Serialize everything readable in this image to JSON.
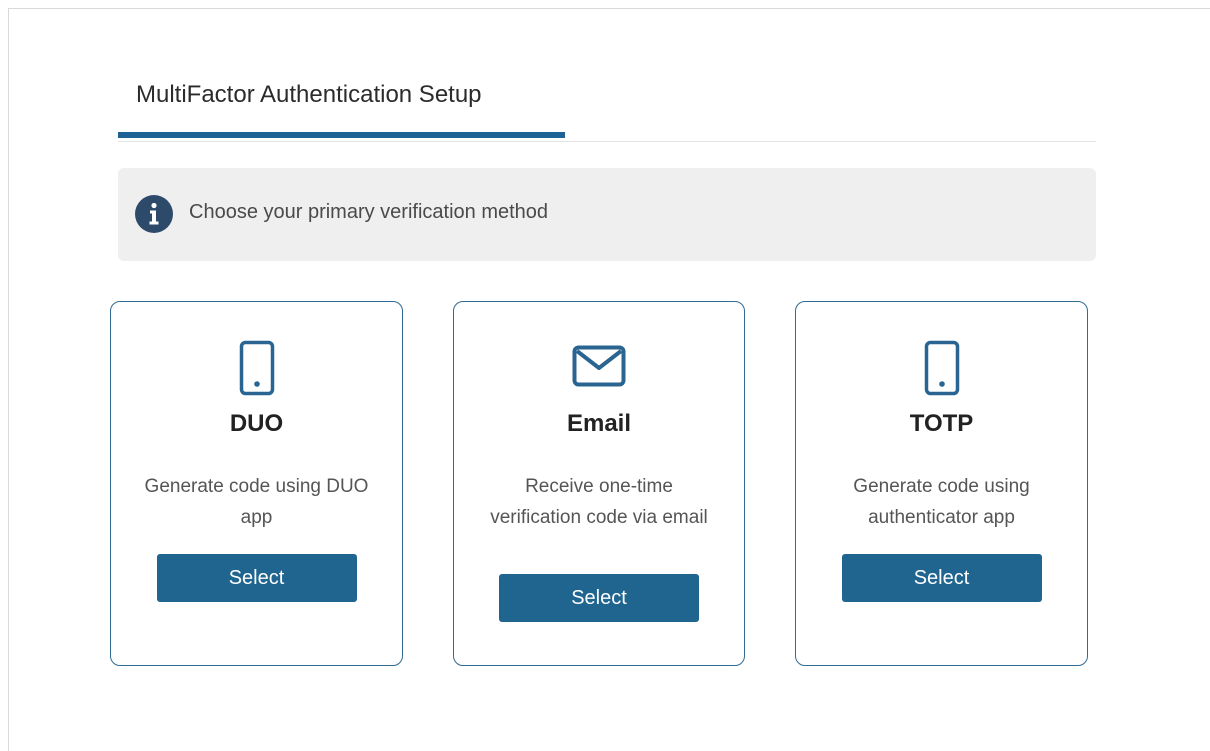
{
  "tab": {
    "label": "MultiFactor Authentication Setup"
  },
  "info": {
    "icon": "info-icon",
    "text": "Choose your primary verification method"
  },
  "colors": {
    "accent": "#1e6393",
    "button": "#1f6590",
    "card_border": "#2f6b94",
    "info_background": "#efefef"
  },
  "cards": [
    {
      "icon": "mobile-phone-icon",
      "title": "DUO",
      "description": "Generate code using DUO app",
      "button_label": "Select"
    },
    {
      "icon": "envelope-icon",
      "title": "Email",
      "description": "Receive one-time verification code via email",
      "button_label": "Select"
    },
    {
      "icon": "mobile-phone-icon",
      "title": "TOTP",
      "description": "Generate code using authenticator app",
      "button_label": "Select"
    }
  ]
}
